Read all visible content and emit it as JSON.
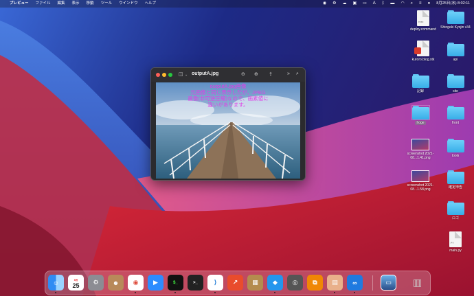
{
  "menubar": {
    "items": [
      "プレビュー",
      "ファイル",
      "編集",
      "表示",
      "移動",
      "ツール",
      "ウインドウ",
      "ヘルプ"
    ],
    "clock": "8月25日(水) 8:02:11",
    "input_indicator": "A"
  },
  "window": {
    "title": "outputA.jpg",
    "overlay_lines": [
      "outputA.jpg画像",
      "元画像と同じ表示しだが、JPEG",
      "画像(非可逆圧縮)なので、画素値に",
      "違いがあります。"
    ]
  },
  "desktop": {
    "left_column": [
      "deploy.command",
      "kuroro.blog.stk",
      "記録",
      "hoge",
      "screenshot 2021-08...1.41.png",
      "screenshot 2021-08...1.58.png"
    ],
    "right_column": [
      "Shingeki Kyojin v34",
      "api",
      "site",
      "front",
      "tools",
      "確定申告",
      "ロゴ",
      "main.py"
    ]
  },
  "dock": {
    "calendar_month": "8月",
    "calendar_day": "25",
    "apps": [
      "finder",
      "calendar",
      "system-preferences",
      "contacts",
      "chrome",
      "zoom",
      "terminal-iterm",
      "terminal",
      "vscode",
      "stockapp",
      "archive-utility",
      "docker",
      "quicktime",
      "drawio",
      "preview",
      "infinity",
      "screenshot",
      "trash"
    ]
  },
  "colors": {
    "overlay_text": "#e13ee6",
    "folder": "#4cc0f4"
  }
}
